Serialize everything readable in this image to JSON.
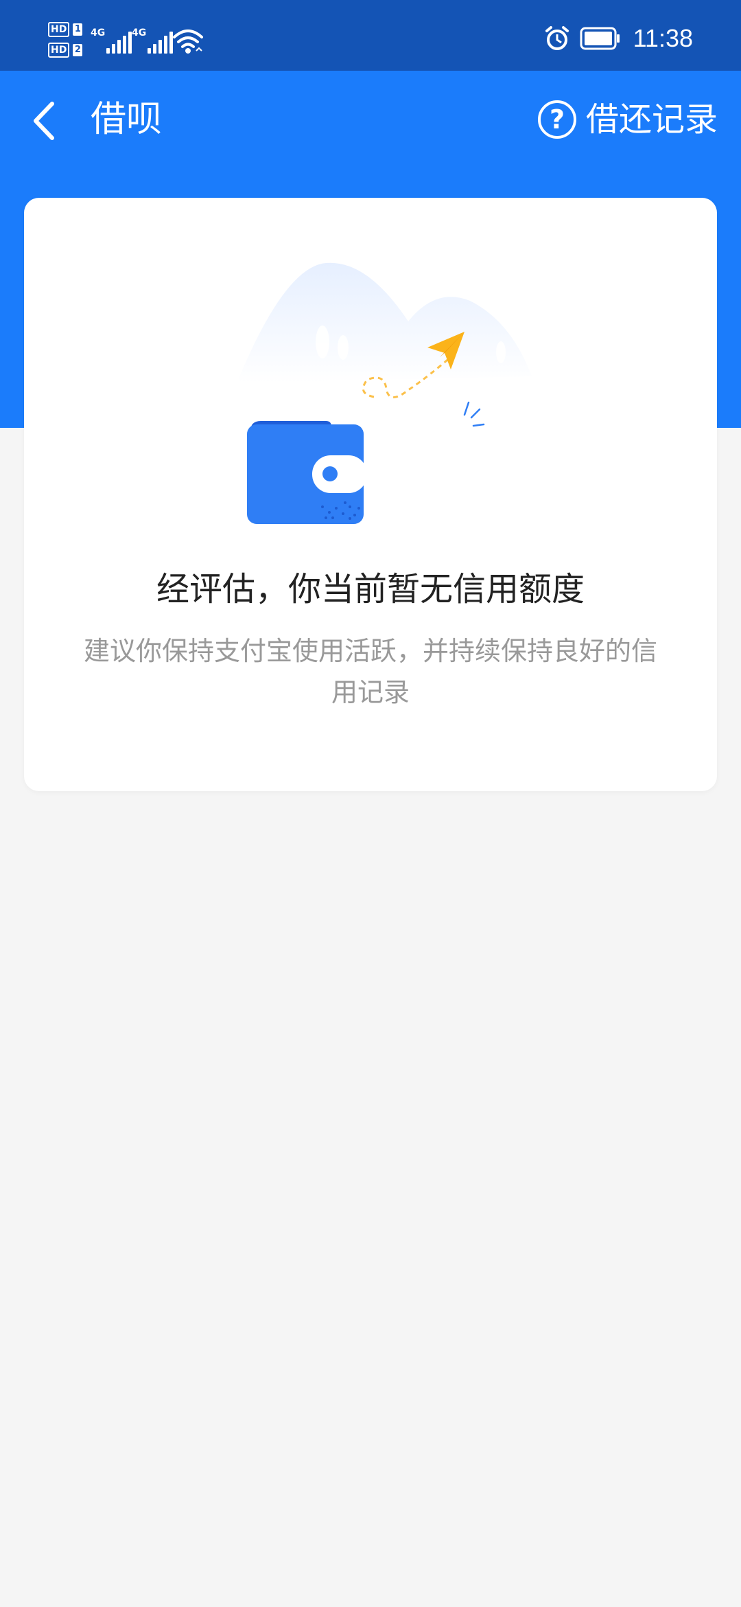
{
  "status_bar": {
    "sim1": {
      "hd": "HD",
      "slot": "1",
      "network": "4G"
    },
    "sim2": {
      "hd": "HD",
      "slot": "2",
      "network": "4G"
    },
    "time": "11:38"
  },
  "header": {
    "title": "借呗",
    "help_label": "借还记录"
  },
  "empty_state": {
    "title": "经评估，你当前暂无信用额度",
    "description": "建议你保持支付宝使用活跃，并持续保持良好的信用记录"
  },
  "colors": {
    "status_bar": "#1454b5",
    "header": "#1b7cfb",
    "wallet": "#2f7ef5",
    "plane": "#fbb31a",
    "background": "#f5f5f5"
  },
  "icons": [
    "back-arrow-icon",
    "help-circle-icon",
    "wifi-icon",
    "alarm-icon",
    "battery-icon",
    "signal-icon"
  ]
}
